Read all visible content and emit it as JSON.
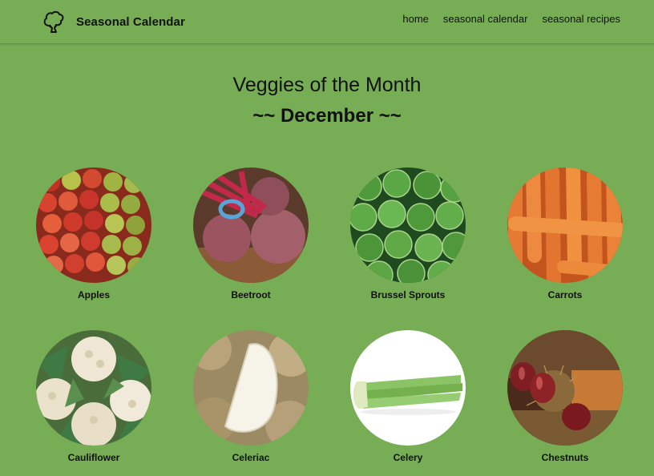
{
  "navbar": {
    "brand": "Seasonal Calendar",
    "brand_icon": "broccoli-icon",
    "links": [
      {
        "label": "home"
      },
      {
        "label": "seasonal calendar"
      },
      {
        "label": "seasonal recipes"
      }
    ]
  },
  "page": {
    "title": "Veggies of the Month",
    "month": "~~ December ~~"
  },
  "veggies": [
    {
      "name": "Apples"
    },
    {
      "name": "Beetroot"
    },
    {
      "name": "Brussel Sprouts"
    },
    {
      "name": "Carrots"
    },
    {
      "name": "Cauliflower"
    },
    {
      "name": "Celeriac"
    },
    {
      "name": "Celery"
    },
    {
      "name": "Chestnuts"
    }
  ],
  "colors": {
    "background": "#76ad55",
    "text": "#111111"
  }
}
